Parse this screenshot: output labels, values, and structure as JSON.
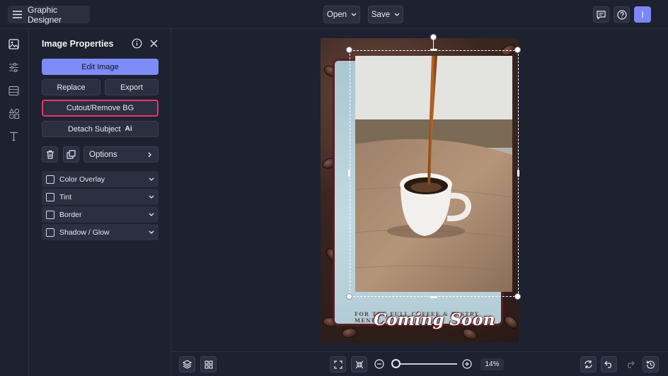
{
  "topbar": {
    "app_title": "Graphic Designer",
    "open_label": "Open",
    "save_label": "Save",
    "avatar_initial": "I"
  },
  "rail": {
    "items": [
      "image-icon",
      "sliders-icon",
      "layout-icon",
      "shapes-icon",
      "text-icon"
    ]
  },
  "panel": {
    "title": "Image Properties",
    "edit_image": "Edit Image",
    "replace": "Replace",
    "export": "Export",
    "cutout": "Cutout/Remove BG",
    "detach": "Detach Subject",
    "detach_badge": "Ai",
    "options": "Options",
    "accordions": [
      {
        "label": "Color Overlay"
      },
      {
        "label": "Tint"
      },
      {
        "label": "Border"
      },
      {
        "label": "Shadow / Glow"
      }
    ]
  },
  "poster": {
    "subtext": "FOR THE FULL COFFEE & PASTRY MENU",
    "coming_soon": "Coming Soon"
  },
  "bottombar": {
    "zoom_value": "14%",
    "zoom_level_fraction": 0.14
  },
  "colors": {
    "accent": "#7e8cf7",
    "highlight_border": "#e6356c",
    "background": "#1e2130",
    "control_bg": "#2b2f40"
  }
}
